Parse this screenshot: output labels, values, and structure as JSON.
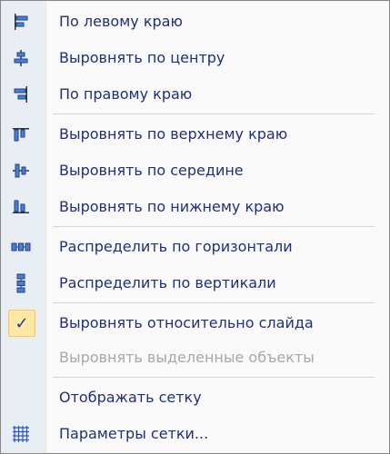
{
  "menu": {
    "items": [
      {
        "label": "По левому краю",
        "icon": "align-left-icon",
        "enabled": true
      },
      {
        "label": "Выровнять по центру",
        "icon": "align-center-icon",
        "enabled": true
      },
      {
        "label": "По правому краю",
        "icon": "align-right-icon",
        "enabled": true
      },
      {
        "label": "Выровнять по верхнему краю",
        "icon": "align-top-icon",
        "enabled": true
      },
      {
        "label": "Выровнять по середине",
        "icon": "align-middle-icon",
        "enabled": true
      },
      {
        "label": "Выровнять по нижнему краю",
        "icon": "align-bottom-icon",
        "enabled": true
      },
      {
        "label": "Распределить по горизонтали",
        "icon": "distribute-horizontally-icon",
        "enabled": true
      },
      {
        "label": "Распределить по вертикали",
        "icon": "distribute-vertically-icon",
        "enabled": true
      },
      {
        "label": "Выровнять относительно слайда",
        "icon": "checkmark-icon",
        "enabled": true,
        "checked": true
      },
      {
        "label": "Выровнять выделенные объекты",
        "icon": null,
        "enabled": false
      },
      {
        "label": "Отображать сетку",
        "icon": null,
        "enabled": true
      },
      {
        "label": "Параметры сетки...",
        "icon": "grid-icon",
        "enabled": true
      }
    ],
    "checkmark_glyph": "✓"
  },
  "colors": {
    "text": "#1f2f7a",
    "disabled_text": "#a7a7a7",
    "gutter": "#e9eef5",
    "check_bg": "#ffe8a5",
    "check_border": "#f2ca58",
    "icon_blue": "#2c58b5"
  }
}
